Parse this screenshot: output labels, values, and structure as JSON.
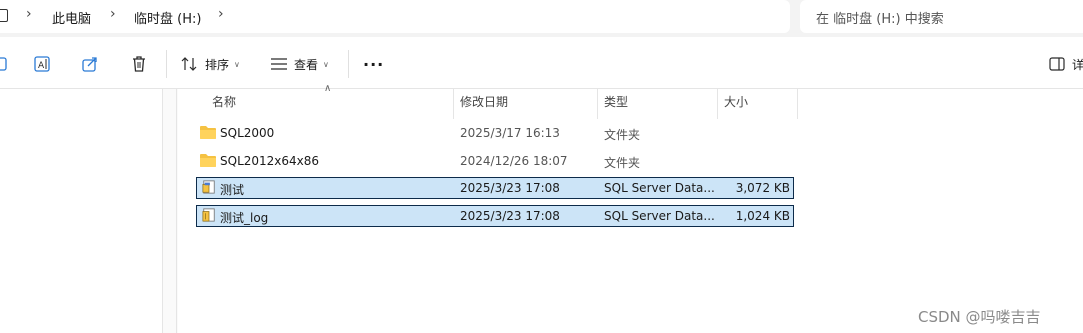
{
  "breadcrumb": {
    "items": [
      "此电脑",
      "临时盘 (H:)"
    ],
    "separator": ">"
  },
  "search": {
    "placeholder": "在 临时盘 (H:) 中搜索"
  },
  "toolbar": {
    "sort_label": "排序",
    "view_label": "查看",
    "more_label": "···",
    "details_label": "详"
  },
  "columns": {
    "name": "名称",
    "modified": "修改日期",
    "type": "类型",
    "size": "大小"
  },
  "files": [
    {
      "icon": "folder-icon",
      "name": "SQL2000",
      "modified": "2025/3/17 16:13",
      "type": "文件夹",
      "size": "",
      "selected": false
    },
    {
      "icon": "folder-icon",
      "name": "SQL2012x64x86",
      "modified": "2024/12/26 18:07",
      "type": "文件夹",
      "size": "",
      "selected": false
    },
    {
      "icon": "database-file-icon",
      "name": "测试",
      "modified": "2025/3/23 17:08",
      "type": "SQL Server Data...",
      "size": "3,072 KB",
      "selected": true
    },
    {
      "icon": "database-log-icon",
      "name": "测试_log",
      "modified": "2025/3/23 17:08",
      "type": "SQL Server Data...",
      "size": "1,024 KB",
      "selected": true
    }
  ],
  "watermark": "CSDN @吗喽吉吉",
  "colors": {
    "selection": "#cce4f7",
    "selection_border": "#0d2b4a",
    "folder": "#f5c242"
  }
}
